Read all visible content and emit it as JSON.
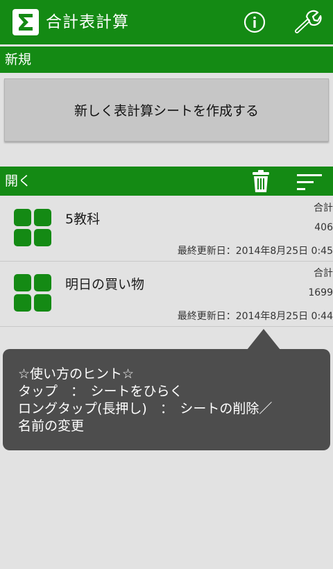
{
  "appbar": {
    "title": "合計表計算"
  },
  "sections": {
    "new_label": "新規",
    "open_label": "開く"
  },
  "create_button": {
    "label": "新しく表計算シートを作成する"
  },
  "sheets": [
    {
      "name": "5教科",
      "sum_label": "合計",
      "sum_value": "406",
      "updated": "最終更新日：2014年8月25日 0:45"
    },
    {
      "name": "明日の買い物",
      "sum_label": "合計",
      "sum_value": "1699",
      "updated": "最終更新日：2014年8月25日 0:44"
    }
  ],
  "tooltip": {
    "lines": [
      "☆使い方のヒント☆",
      "タップ　：　シートをひらく",
      "ロングタップ(長押し)　：　シートの削除／",
      "名前の変更"
    ]
  },
  "colors": {
    "accent": "#148a14",
    "tooltip_bg": "#4d4d4d",
    "background": "#e2e2e2"
  }
}
